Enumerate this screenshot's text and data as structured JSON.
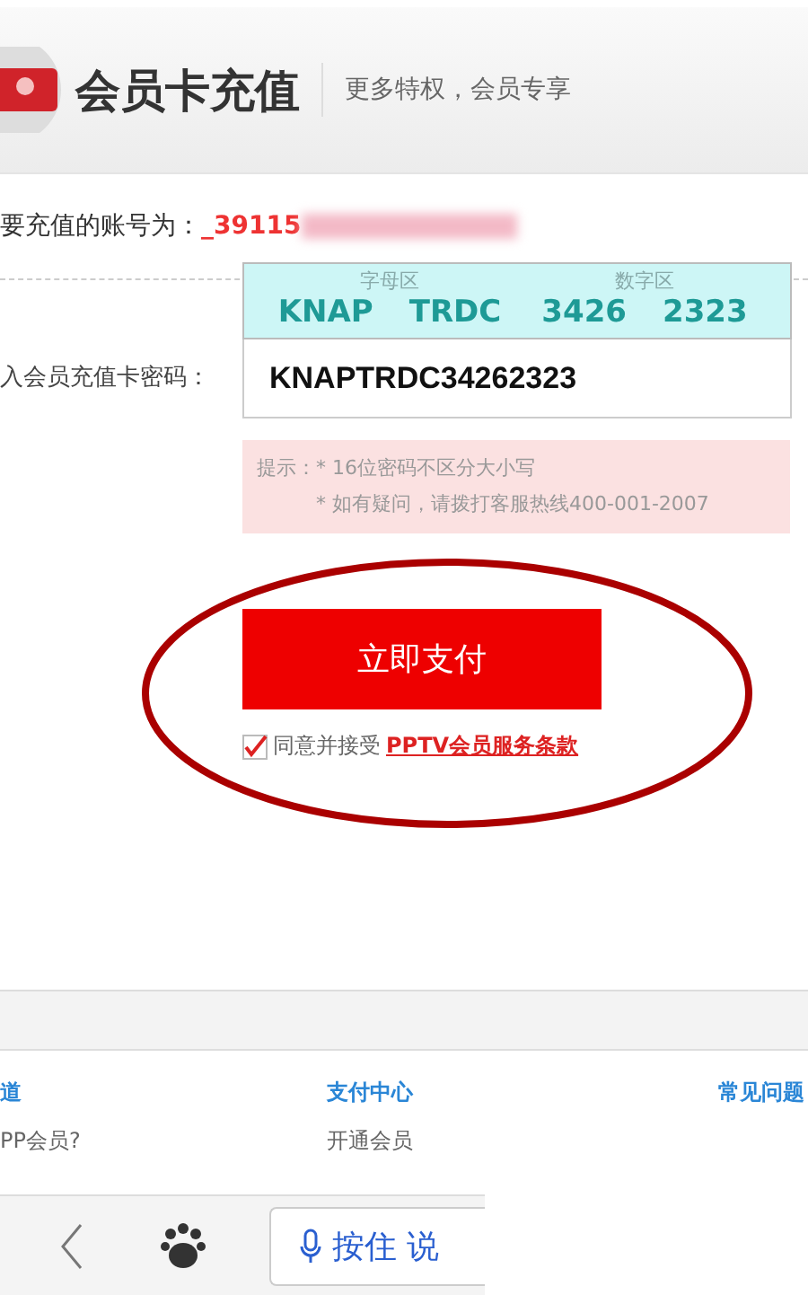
{
  "header": {
    "title": "会员卡充值",
    "subtitle": "更多特权，会员专享"
  },
  "account": {
    "label": "要充值的账号为：",
    "value": "_39115"
  },
  "card_guide": {
    "zones": [
      "字母区",
      "数字区"
    ],
    "groups": [
      "KNAP",
      "TRDC",
      "3426",
      "2323"
    ]
  },
  "password": {
    "label": "入会员充值卡密码：",
    "value": "KNAPTRDC34262323"
  },
  "hints": {
    "label": "提示：",
    "lines": [
      "* 16位密码不区分大小写",
      "* 如有疑问，请拨打客服热线400-001-2007"
    ]
  },
  "pay_button": "立即支付",
  "agreement": {
    "checked": true,
    "text": "同意并接受",
    "link": "PPTV会员服务条款"
  },
  "footer_columns": [
    {
      "title": "道",
      "items": [
        "PP会员?"
      ]
    },
    {
      "title": "支付中心",
      "items": [
        "开通会员"
      ]
    },
    {
      "title": "常见问题"
    }
  ],
  "toolbar": {
    "voice_label": "按住 说"
  }
}
